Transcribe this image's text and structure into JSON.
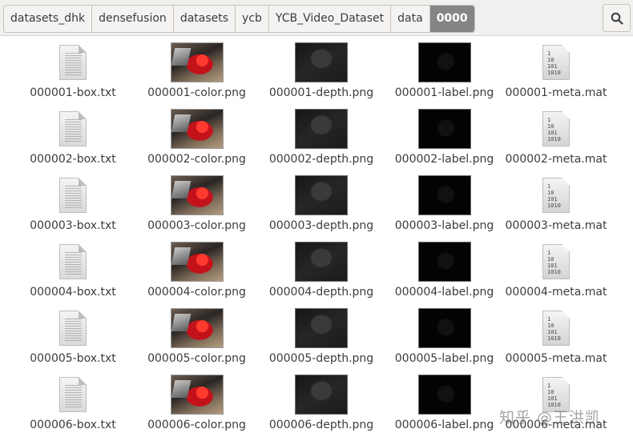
{
  "breadcrumb": [
    "datasets_dhk",
    "densefusion",
    "datasets",
    "ycb",
    "YCB_Video_Dataset",
    "data",
    "0000"
  ],
  "active_crumb_index": 6,
  "search_icon": "search-icon",
  "icons": {
    "box": "text-document-icon",
    "color": "image-thumbnail",
    "depth": "image-thumbnail",
    "label": "image-thumbnail",
    "meta": "binary-file-icon"
  },
  "binary_icon_text": [
    "1",
    "10",
    "101",
    "1010"
  ],
  "files": [
    {
      "box": "000001-box.txt",
      "color": "000001-color.png",
      "depth": "000001-depth.png",
      "label": "000001-label.png",
      "meta": "000001-meta.mat"
    },
    {
      "box": "000002-box.txt",
      "color": "000002-color.png",
      "depth": "000002-depth.png",
      "label": "000002-label.png",
      "meta": "000002-meta.mat"
    },
    {
      "box": "000003-box.txt",
      "color": "000003-color.png",
      "depth": "000003-depth.png",
      "label": "000003-label.png",
      "meta": "000003-meta.mat"
    },
    {
      "box": "000004-box.txt",
      "color": "000004-color.png",
      "depth": "000004-depth.png",
      "label": "000004-label.png",
      "meta": "000004-meta.mat"
    },
    {
      "box": "000005-box.txt",
      "color": "000005-color.png",
      "depth": "000005-depth.png",
      "label": "000005-label.png",
      "meta": "000005-meta.mat"
    },
    {
      "box": "000006-box.txt",
      "color": "000006-color.png",
      "depth": "000006-depth.png",
      "label": "000006-label.png",
      "meta": "000006-meta.mat"
    }
  ],
  "watermark": "知乎 @王洪凯"
}
